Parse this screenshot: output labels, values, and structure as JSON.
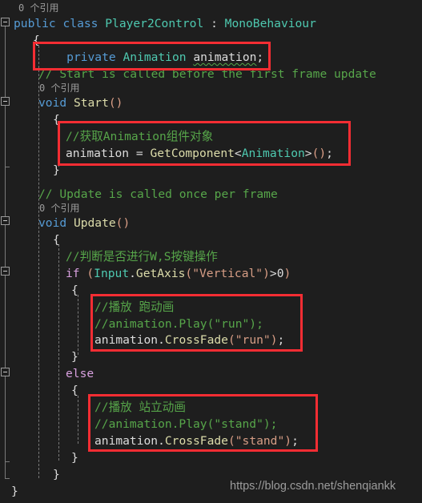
{
  "editor": {
    "theme": "vs-dark",
    "background": "#1E1E1E",
    "colors": {
      "keyword": "#569CD6",
      "control_keyword": "#D8A0DF",
      "type": "#4EC9B0",
      "identifier": "#DCDCDC",
      "method": "#DCDCAA",
      "string": "#D69D85",
      "comment": "#57A64A",
      "codelens": "#9B9B9B",
      "annotation_red": "#F52D33",
      "guide": "#7A7A7A"
    }
  },
  "codelens": {
    "class_ref": "0 个引用",
    "start_ref": "0 个引用",
    "update_ref": "0 个引用"
  },
  "code": {
    "l01_class_decl": {
      "kw_public": "public",
      "kw_class": "class",
      "name": "Player2Control",
      "colon": ":",
      "base": "MonoBehaviour"
    },
    "l02_open_brace": "{",
    "l03_field": {
      "kw_private": "private",
      "type": "Animation",
      "name": "animation",
      "semi": ";"
    },
    "l04_comment_start": "// Start is called before the first frame update",
    "l05_start_sig": {
      "kw_void": "void",
      "name": "Start",
      "parens": "()"
    },
    "l06_open_brace": "{",
    "l07_comment_getcomp": "//获取Animation组件对象",
    "l08_getcomponent": {
      "target": "animation",
      "eq": "=",
      "method": "GetComponent",
      "lt": "<",
      "generic": "Animation",
      "gt": ">",
      "parens": "()",
      "semi": ";"
    },
    "l09_close_brace": "}",
    "l10_comment_update": "// Update is called once per frame",
    "l11_update_sig": {
      "kw_void": "void",
      "name": "Update",
      "parens": "()"
    },
    "l12_open_brace": "{",
    "l13_comment_ws": "//判断是否进行W,S按键操作",
    "l14_if": {
      "kw_if": "if",
      "lparen": "(",
      "type": "Input",
      "dot": ".",
      "method": "GetAxis",
      "lparen2": "(",
      "string": "\"Vertical\"",
      "rparen2": ")",
      "op": ">",
      "num": "0",
      "rparen": ")"
    },
    "l15_open_brace": "{",
    "l16_comment_run": "//播放 跑动画",
    "l17_comment_play_run": "//animation.Play(\"run\");",
    "l18_crossfade_run": {
      "target": "animation",
      "dot": ".",
      "method": "CrossFade",
      "lparen": "(",
      "string": "\"run\"",
      "rparen": ")",
      "semi": ";"
    },
    "l19_close_brace": "}",
    "l20_else": "else",
    "l21_open_brace": "{",
    "l22_comment_stand": "//播放 站立动画",
    "l23_comment_play_stand": "//animation.Play(\"stand\");",
    "l24_crossfade_stand": {
      "target": "animation",
      "dot": ".",
      "method": "CrossFade",
      "lparen": "(",
      "string": "\"stand\"",
      "rparen": ")",
      "semi": ";"
    },
    "l25_close_brace": "}",
    "l26_close_brace": "}",
    "l27_close_brace": "}"
  },
  "annotations": {
    "box1_label": "private Animation animation;",
    "box2_label": "//获取Animation组件对象 + GetComponent",
    "box3_label": "//播放 跑动画 + CrossFade run",
    "box4_label": "//播放 站立动画 + CrossFade stand"
  },
  "watermark": {
    "url": "https://blog.csdn.net/shenqiankk"
  }
}
